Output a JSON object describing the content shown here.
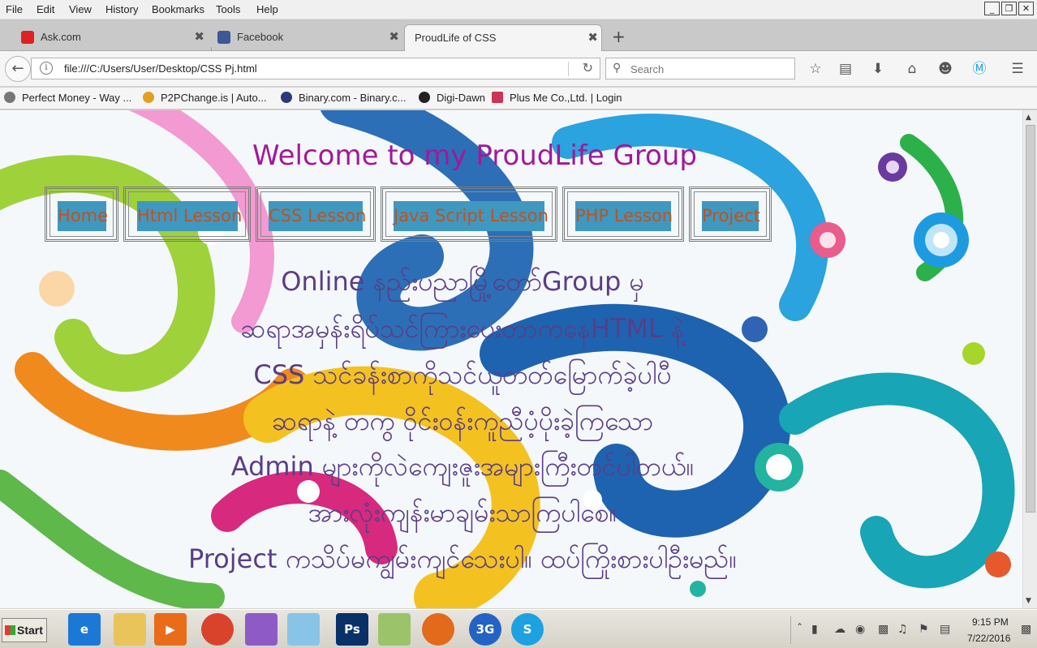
{
  "menu": [
    "File",
    "Edit",
    "View",
    "History",
    "Bookmarks",
    "Tools",
    "Help"
  ],
  "window_buttons": {
    "minimize": "_",
    "maximize": "❐",
    "close": "✕"
  },
  "tabs": [
    {
      "label": "Ask.com",
      "icon": "ask-icon",
      "active": false
    },
    {
      "label": "Facebook",
      "icon": "facebook-icon",
      "active": false
    },
    {
      "label": "ProudLife of CSS",
      "icon": "",
      "active": true
    }
  ],
  "tab_close": "✖",
  "new_tab": "+",
  "address": {
    "url": "file:///C:/Users/User/Desktop/CSS Pj.html"
  },
  "search": {
    "placeholder": "Search"
  },
  "toolbar_icons": [
    "bookmark-star-icon",
    "reading-list-icon",
    "downloads-icon",
    "home-icon",
    "chat-icon",
    "skype-icon",
    "menu-icon"
  ],
  "bookmarks": [
    {
      "label": "Perfect Money - Way ...",
      "color": "#777777"
    },
    {
      "label": "P2PChange.is | Auto...",
      "color": "#e0a020"
    },
    {
      "label": "Binary.com - Binary.c...",
      "color": "#2a3a7a"
    },
    {
      "label": "Digi-Dawn",
      "color": "#222222"
    },
    {
      "label": "Plus Me Co.,Ltd. | Login",
      "color": "#cc3355"
    }
  ],
  "page": {
    "title": "Welcome to my ProudLife Group",
    "nav": [
      "Home",
      "Html Lesson",
      "CSS Lesson",
      "Java Script Lesson",
      "PHP Lesson",
      "Project"
    ],
    "paragraph_lines": [
      "Online နည်းပညာမြို့တော်Group မှ",
      "ဆရာအမှန်းရိပ်သင်ကြားပေးတာကနေHTML နဲ့",
      "CSS သင်ခန်းစာကိုသင်ယူတတ်မြောက်ခဲ့ပါပီ",
      "ဆရာနဲ့ တကွ ဝိုင်းဝန်းကူညီပံ့ပိုးခဲ့ကြသော",
      "Admin များကိုလဲကျေးဇူးအများကြီးတင်ပါတယ်။",
      "အားလုံးကျန်းမာချမ်းသာကြပါစေ။",
      "Project ကသိပ်မကျွမ်းကျင်သေးပါ။ ထပ်ကြိုးစားပါဦးမည်။"
    ]
  },
  "taskbar": {
    "start_label": "Start",
    "apps": [
      "ie-icon",
      "folder-icon",
      "media-player-icon",
      "chrome-icon",
      "feather-icon",
      "notepad-icon",
      "photoshop-icon",
      "paint-icon",
      "firefox-icon",
      "3g-icon",
      "skype-icon"
    ],
    "photoshop_label": "Ps",
    "threeg_label": "3G",
    "clock_time": "9:15 PM",
    "clock_date": "7/22/2016"
  },
  "colors": {
    "title": "#a3189a",
    "nav_bg": "#3f98c0",
    "nav_text": "#c0521e",
    "paragraph": "#5a3d86"
  }
}
